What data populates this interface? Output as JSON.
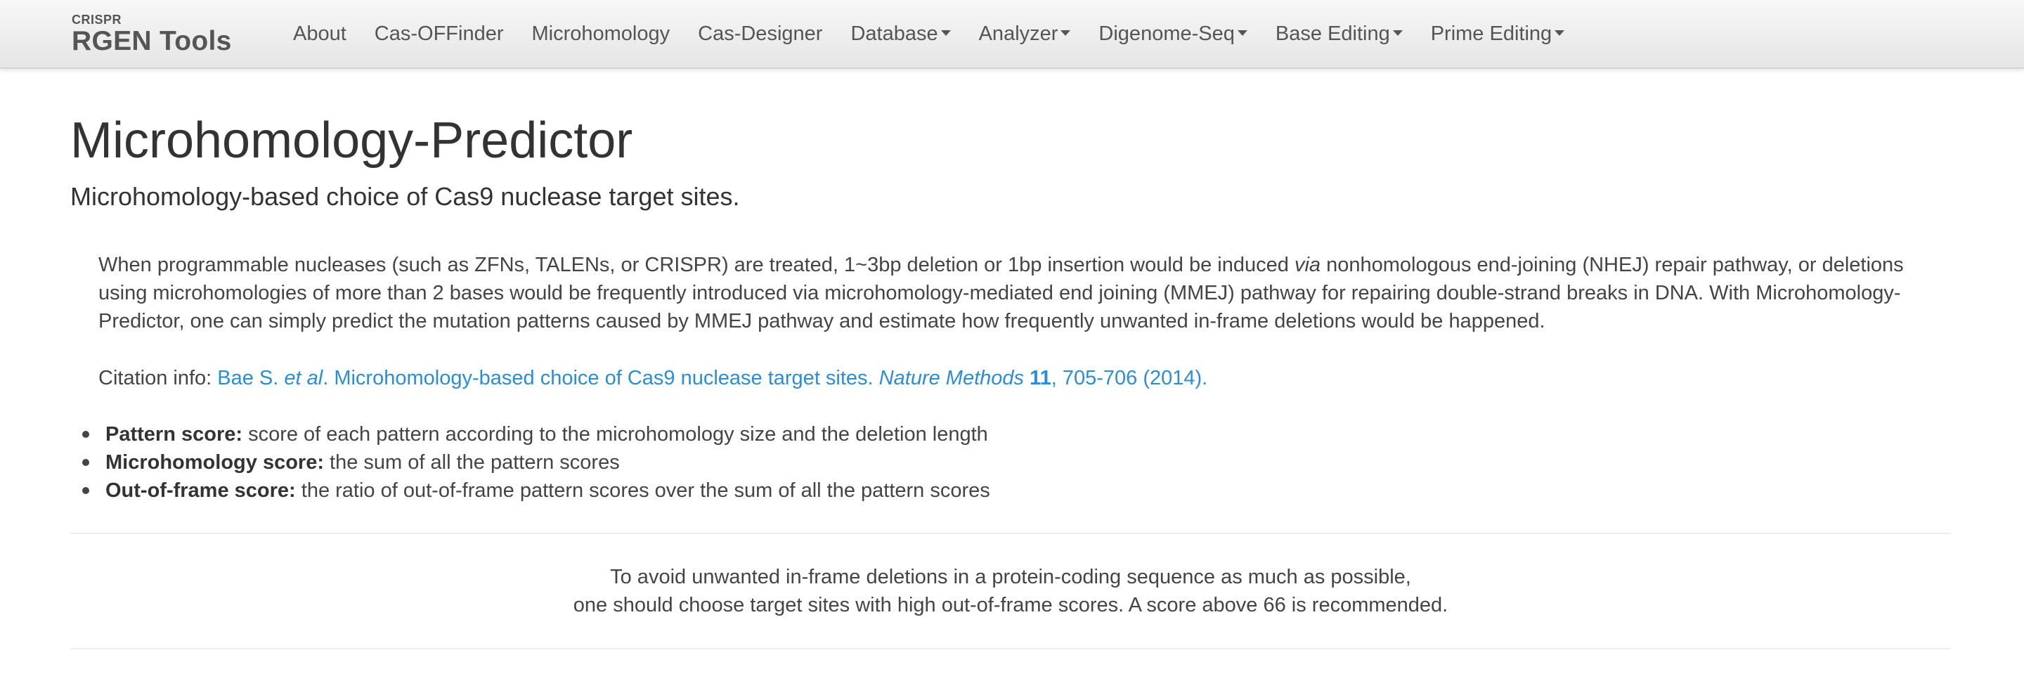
{
  "brand": {
    "small": "CRISPR",
    "main": "RGEN Tools"
  },
  "nav": {
    "items": [
      {
        "label": "About",
        "dropdown": false
      },
      {
        "label": "Cas-OFFinder",
        "dropdown": false
      },
      {
        "label": "Microhomology",
        "dropdown": false
      },
      {
        "label": "Cas-Designer",
        "dropdown": false
      },
      {
        "label": "Database",
        "dropdown": true
      },
      {
        "label": "Analyzer",
        "dropdown": true
      },
      {
        "label": "Digenome-Seq",
        "dropdown": true
      },
      {
        "label": "Base Editing",
        "dropdown": true
      },
      {
        "label": "Prime Editing",
        "dropdown": true
      }
    ]
  },
  "page": {
    "title": "Microhomology-Predictor",
    "subtitle": "Microhomology-based choice of Cas9 nuclease target sites."
  },
  "description": {
    "part1": "When programmable nucleases (such as ZFNs, TALENs, or CRISPR) are treated, 1~3bp deletion or 1bp insertion would be induced ",
    "via": "via",
    "part2": " nonhomologous end-joining (NHEJ) repair pathway, or deletions using microhomologies of more than 2 bases would be frequently introduced via microhomology-mediated end joining (MMEJ) pathway for repairing double-strand breaks in DNA. With Microhomology-Predictor, one can simply predict the mutation patterns caused by MMEJ pathway and estimate how frequently unwanted in-frame deletions would be happened."
  },
  "citation": {
    "label": "Citation info: ",
    "authors": "Bae S. ",
    "etal": "et al",
    "title": ". Microhomology-based choice of Cas9 nuclease target sites. ",
    "journal": "Nature Methods",
    "volume": "11",
    "pages": ", 705-706 (2014)."
  },
  "definitions": [
    {
      "term": "Pattern score:",
      "text": " score of each pattern according to the microhomology size and the deletion length"
    },
    {
      "term": "Microhomology score:",
      "text": " the sum of all the pattern scores"
    },
    {
      "term": "Out-of-frame score:",
      "text": " the ratio of out-of-frame pattern scores over the sum of all the pattern scores"
    }
  ],
  "note": {
    "line1": "To avoid unwanted in-frame deletions in a protein-coding sequence as much as possible,",
    "line2": "one should choose target sites with high out-of-frame scores. A score above 66 is recommended."
  },
  "colors": {
    "link": "#2a8ed6",
    "navbar": "#eeeeee",
    "text": "#333333"
  }
}
